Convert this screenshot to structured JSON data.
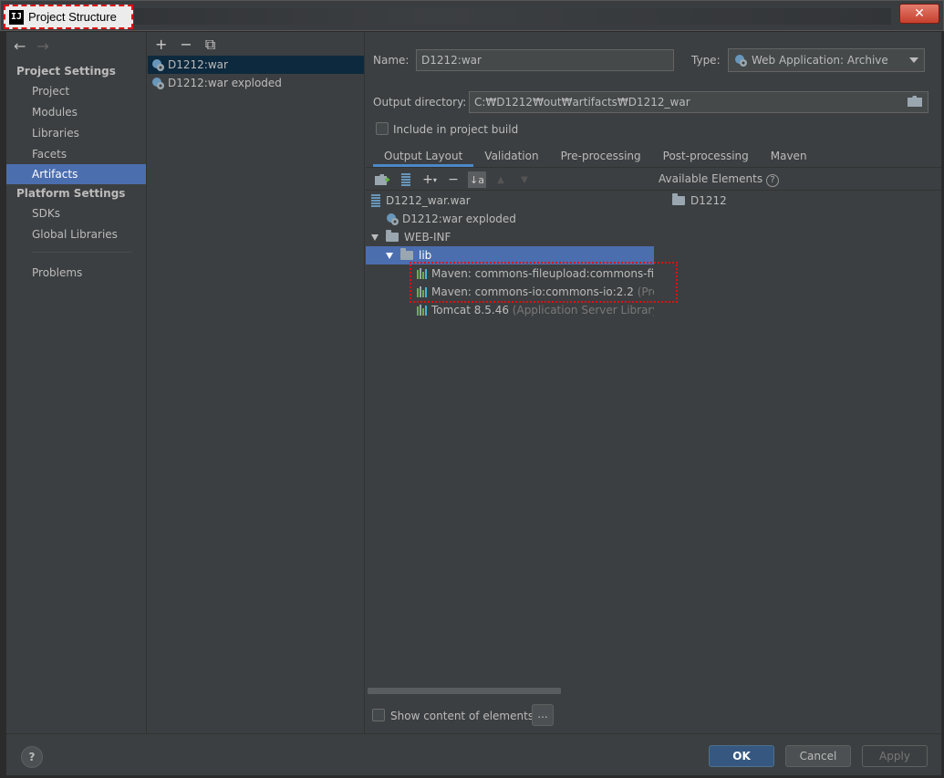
{
  "window": {
    "title": "Project Structure",
    "app_icon": "IJ",
    "close_glyph": "✕"
  },
  "nav": {
    "back_arrow": "←",
    "forward_arrow": "→",
    "project_settings_header": "Project Settings",
    "project_settings": [
      "Project",
      "Modules",
      "Libraries",
      "Facets",
      "Artifacts"
    ],
    "selected": "Artifacts",
    "platform_settings_header": "Platform Settings",
    "platform_settings": [
      "SDKs",
      "Global Libraries"
    ],
    "problems": "Problems"
  },
  "artifact_list": {
    "toolbar": {
      "add": "+",
      "remove": "−",
      "copy": "⧉"
    },
    "items": [
      "D1212:war",
      "D1212:war exploded"
    ]
  },
  "details": {
    "name_label": "Name:",
    "name_value": "D1212:war",
    "type_label": "Type:",
    "type_value": "Web Application: Archive",
    "output_dir_label": "Output directory:",
    "output_dir_value": "C:₩D1212₩out₩artifacts₩D1212_war",
    "include_build_label": "Include in project build",
    "include_build_checked": false,
    "tabs": [
      "Output Layout",
      "Validation",
      "Pre-processing",
      "Post-processing",
      "Maven"
    ],
    "active_tab": "Output Layout",
    "available_elements_label": "Available Elements",
    "help_glyph": "?",
    "tree": {
      "root": "D1212_war.war",
      "exploded": "D1212:war exploded",
      "webinf": "WEB-INF",
      "lib": "lib",
      "libs": [
        {
          "name": "Maven: commons-fileupload:commons-fileu",
          "suffix": ""
        },
        {
          "name": "Maven: commons-io:commons-io:2.2",
          "suffix": "(Proje"
        },
        {
          "name": "Tomcat 8.5.46",
          "suffix": "(Application Server Library)"
        }
      ]
    },
    "available": [
      "D1212"
    ],
    "show_content_label": "Show content of elements",
    "more_button": "..."
  },
  "buttons": {
    "ok": "OK",
    "cancel": "Cancel",
    "apply": "Apply",
    "help": "?"
  },
  "colors": {
    "selection": "#4b6eaf",
    "highlight_box": "#dd1111",
    "primary_button": "#365880"
  }
}
